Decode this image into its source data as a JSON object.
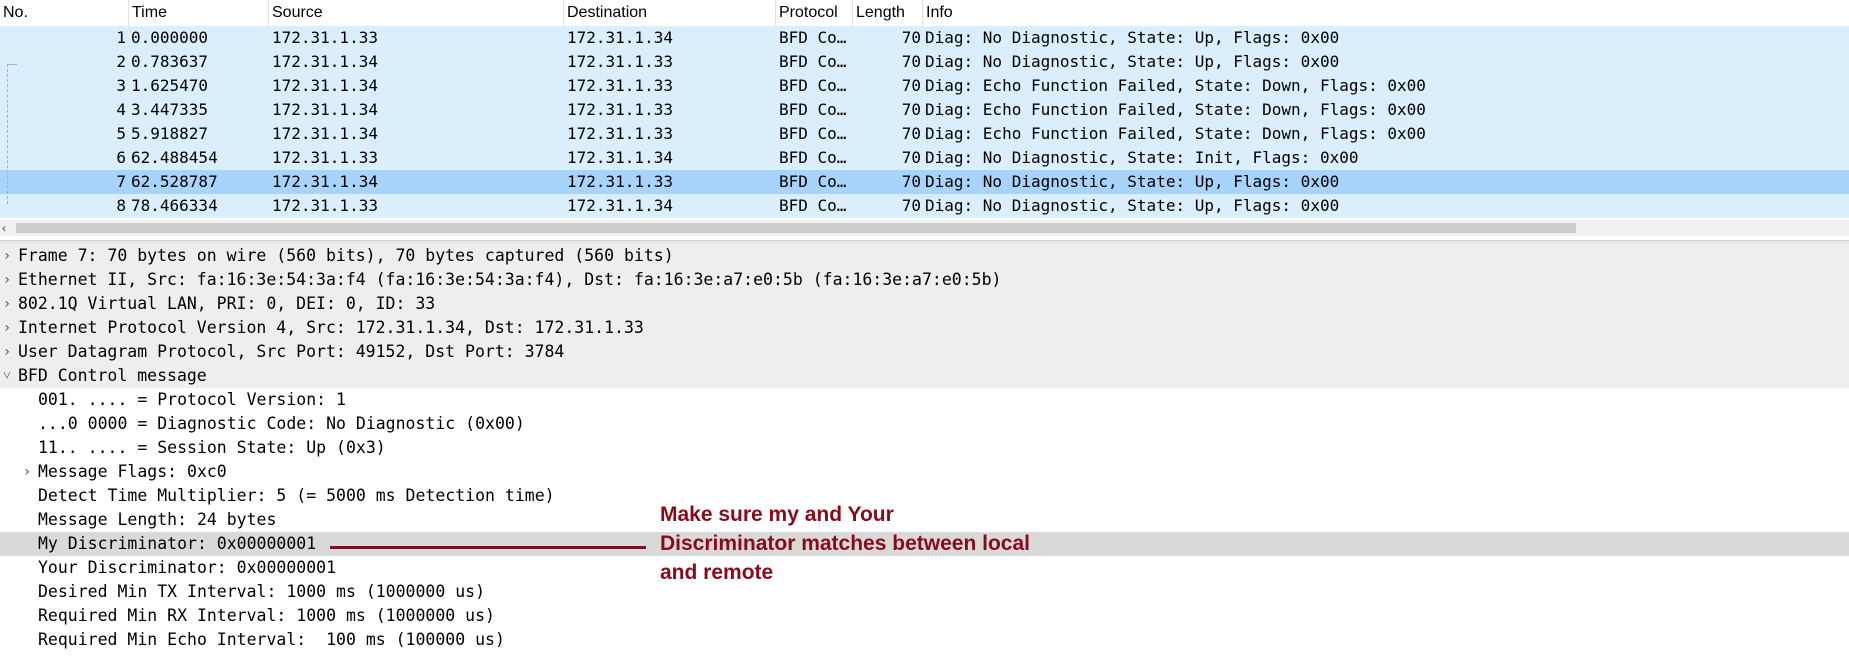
{
  "columns": {
    "no": "No.",
    "time": "Time",
    "source": "Source",
    "destination": "Destination",
    "protocol": "Protocol",
    "length": "Length",
    "info": "Info"
  },
  "packets": [
    {
      "no": "1",
      "time": "0.000000",
      "source": "172.31.1.33",
      "destination": "172.31.1.34",
      "protocol": "BFD Co…",
      "length": "70",
      "info": "Diag: No Diagnostic, State: Up, Flags: 0x00"
    },
    {
      "no": "2",
      "time": "0.783637",
      "source": "172.31.1.34",
      "destination": "172.31.1.33",
      "protocol": "BFD Co…",
      "length": "70",
      "info": "Diag: No Diagnostic, State: Up, Flags: 0x00"
    },
    {
      "no": "3",
      "time": "1.625470",
      "source": "172.31.1.34",
      "destination": "172.31.1.33",
      "protocol": "BFD Co…",
      "length": "70",
      "info": "Diag: Echo Function Failed, State: Down, Flags: 0x00"
    },
    {
      "no": "4",
      "time": "3.447335",
      "source": "172.31.1.34",
      "destination": "172.31.1.33",
      "protocol": "BFD Co…",
      "length": "70",
      "info": "Diag: Echo Function Failed, State: Down, Flags: 0x00"
    },
    {
      "no": "5",
      "time": "5.918827",
      "source": "172.31.1.34",
      "destination": "172.31.1.33",
      "protocol": "BFD Co…",
      "length": "70",
      "info": "Diag: Echo Function Failed, State: Down, Flags: 0x00"
    },
    {
      "no": "6",
      "time": "62.488454",
      "source": "172.31.1.33",
      "destination": "172.31.1.34",
      "protocol": "BFD Co…",
      "length": "70",
      "info": "Diag: No Diagnostic, State: Init, Flags: 0x00"
    },
    {
      "no": "7",
      "time": "62.528787",
      "source": "172.31.1.34",
      "destination": "172.31.1.33",
      "protocol": "BFD Co…",
      "length": "70",
      "info": "Diag: No Diagnostic, State: Up, Flags: 0x00"
    },
    {
      "no": "8",
      "time": "78.466334",
      "source": "172.31.1.33",
      "destination": "172.31.1.34",
      "protocol": "BFD Co…",
      "length": "70",
      "info": "Diag: No Diagnostic, State: Up, Flags: 0x00"
    }
  ],
  "selected_packet": "7",
  "details": [
    {
      "text": "Frame 7: 70 bytes on wire (560 bits), 70 bytes captured (560 bits)",
      "level": 0,
      "expander": "collapsed"
    },
    {
      "text": "Ethernet II, Src: fa:16:3e:54:3a:f4 (fa:16:3e:54:3a:f4), Dst: fa:16:3e:a7:e0:5b (fa:16:3e:a7:e0:5b)",
      "level": 0,
      "expander": "collapsed"
    },
    {
      "text": "802.1Q Virtual LAN, PRI: 0, DEI: 0, ID: 33",
      "level": 0,
      "expander": "collapsed"
    },
    {
      "text": "Internet Protocol Version 4, Src: 172.31.1.34, Dst: 172.31.1.33",
      "level": 0,
      "expander": "collapsed"
    },
    {
      "text": "User Datagram Protocol, Src Port: 49152, Dst Port: 3784",
      "level": 0,
      "expander": "collapsed"
    },
    {
      "text": "BFD Control message",
      "level": 0,
      "expander": "expanded"
    },
    {
      "text": "001. .... = Protocol Version: 1",
      "level": 1,
      "expander": "none"
    },
    {
      "text": "...0 0000 = Diagnostic Code: No Diagnostic (0x00)",
      "level": 1,
      "expander": "none"
    },
    {
      "text": "11.. .... = Session State: Up (0x3)",
      "level": 1,
      "expander": "none"
    },
    {
      "text": "Message Flags: 0xc0",
      "level": 1,
      "expander": "collapsed"
    },
    {
      "text": "Detect Time Multiplier: 5 (= 5000 ms Detection time)",
      "level": 1,
      "expander": "none"
    },
    {
      "text": "Message Length: 24 bytes",
      "level": 1,
      "expander": "none"
    },
    {
      "text": "My Discriminator: 0x00000001",
      "level": 1,
      "expander": "none",
      "highlighted": true
    },
    {
      "text": "Your Discriminator: 0x00000001",
      "level": 1,
      "expander": "none"
    },
    {
      "text": "Desired Min TX Interval: 1000 ms (1000000 us)",
      "level": 1,
      "expander": "none"
    },
    {
      "text": "Required Min RX Interval: 1000 ms (1000000 us)",
      "level": 1,
      "expander": "none"
    },
    {
      "text": "Required Min Echo Interval:  100 ms (100000 us)",
      "level": 1,
      "expander": "none"
    }
  ],
  "annotation": {
    "lines": [
      "Make sure my and Your",
      "Discriminator matches between local",
      "and remote"
    ],
    "color": "#8b0a1a"
  },
  "colors": {
    "row_bg": "#dbeefc",
    "row_selected": "#a8d4fb",
    "detail_highlight": "#d9d9d9"
  },
  "icons": {
    "collapsed": "chevron-right-icon",
    "expanded": "chevron-down-icon"
  }
}
